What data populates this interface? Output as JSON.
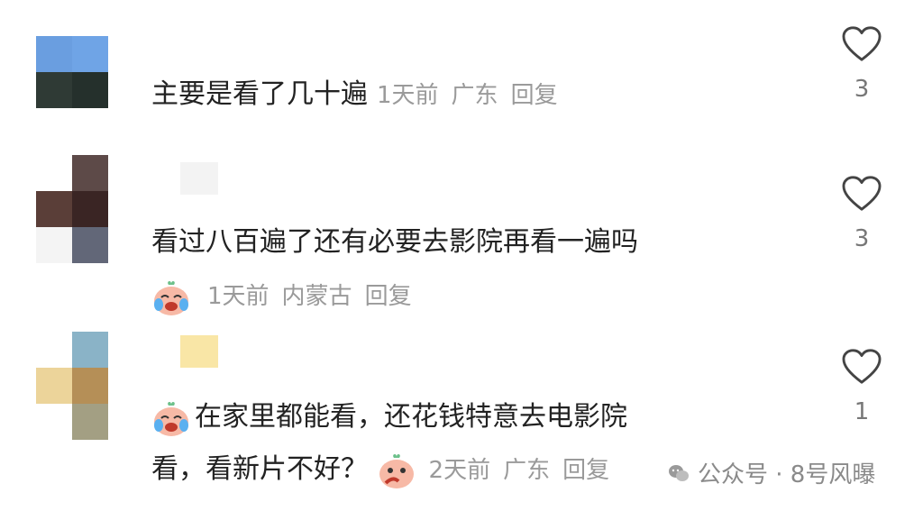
{
  "comments": [
    {
      "text": "主要是看了几十遍",
      "time": "1天前",
      "location": "广东",
      "reply": "回复",
      "likes": "3",
      "avatar_colors": [
        "#6a9ee0",
        "#6fa4e6",
        "#2f3a35",
        "#25302c"
      ]
    },
    {
      "text": "看过八百遍了还有必要去影院再看一遍吗",
      "time": "1天前",
      "location": "内蒙古",
      "reply": "回复",
      "likes": "3",
      "avatar_colors": [
        "#ffffff",
        "#5d4a48",
        "#5a3e38",
        "#3a2524",
        "#f4f4f4",
        "#626778"
      ]
    },
    {
      "text_line1": "在家里都能看，还花钱特意去电影院",
      "text_line2": "看，看新片不好？",
      "time": "2天前",
      "location": "广东",
      "reply": "回复",
      "likes": "1",
      "avatar_colors": [
        "#ffffff",
        "#8ab3c7",
        "#ecd49a",
        "#b58f57",
        "#ffffff",
        "#a39f83"
      ]
    }
  ],
  "watermark": {
    "text": "公众号 · 8号风曝"
  },
  "icons": {
    "like": "heart-outline-icon",
    "emoji": "crying-laughing-face-icon",
    "emoji_think": "thinking-face-icon",
    "watermark": "wechat-icon"
  }
}
